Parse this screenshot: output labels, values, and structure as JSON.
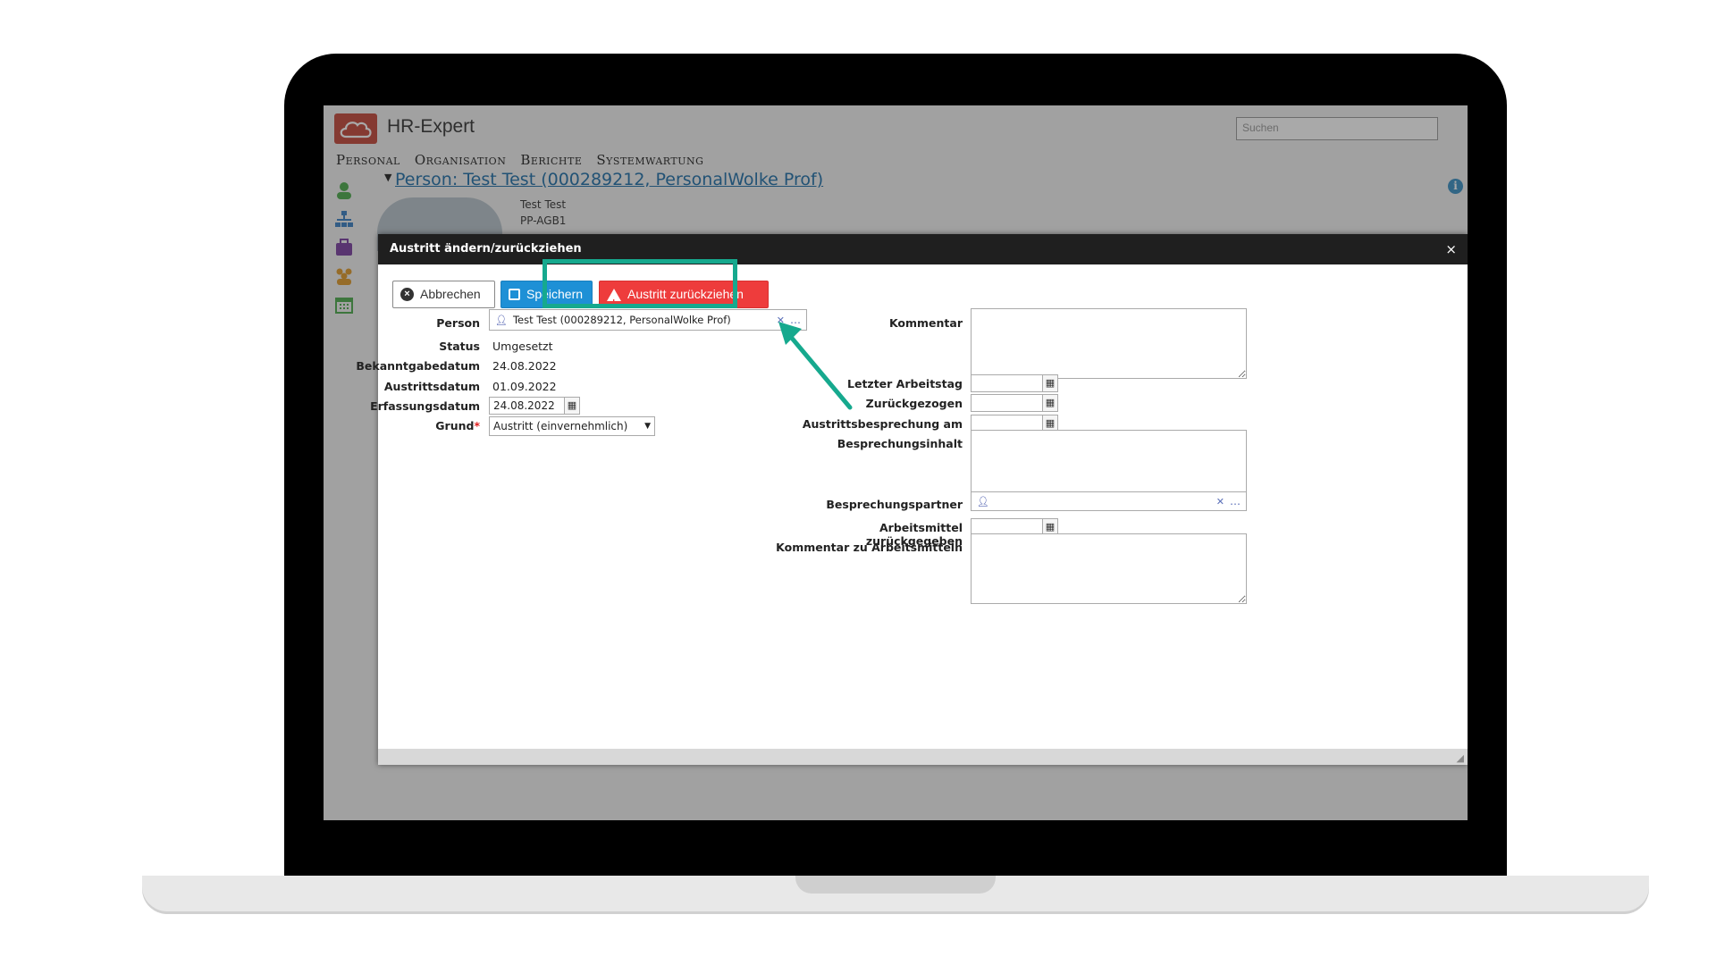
{
  "app": {
    "title": "HR-Expert",
    "search_placeholder": "Suchen",
    "menu": [
      "Personal",
      "Organisation",
      "Berichte",
      "Systemwartung"
    ],
    "person_header": "Person: Test Test (000289212, PersonalWolke Prof)",
    "person_sub_name": "Test Test",
    "person_sub_code": "PP-AGB1"
  },
  "dialog": {
    "title": "Austritt ändern/zurückziehen",
    "close": "×",
    "buttons": {
      "cancel": "Abbrechen",
      "save": "Speichern",
      "revoke": "Austritt zurückziehen"
    },
    "left": {
      "person_label": "Person",
      "person_value": "Test Test (000289212, PersonalWolke Prof)",
      "status_label": "Status",
      "status_value": "Umgesetzt",
      "announce_label": "Bekanntgabedatum",
      "announce_value": "24.08.2022",
      "exit_label": "Austrittsdatum",
      "exit_value": "01.09.2022",
      "record_label": "Erfassungsdatum",
      "record_value": "24.08.2022",
      "reason_label": "Grund",
      "reason_required": "*",
      "reason_value": "Austritt (einvernehmlich)"
    },
    "right": {
      "comment_label": "Kommentar",
      "comment_value": "",
      "last_day_label": "Letzter Arbeitstag",
      "last_day_value": "",
      "withdrawn_label": "Zurückgezogen",
      "withdrawn_value": "",
      "exit_talk_label": "Austrittsbesprechung am",
      "exit_talk_value": "",
      "talk_content_label": "Besprechungsinhalt",
      "talk_content_value": "",
      "talk_partner_label": "Besprechungspartner",
      "talk_partner_value": "",
      "equipment_label": "Arbeitsmittel zurückgegeben",
      "equipment_value": "",
      "equipment_comment_label": "Kommentar zu Arbeitsmitteln",
      "equipment_comment_value": ""
    }
  },
  "colors": {
    "highlight": "#16a98e",
    "revoke_button": "#ee3c3c",
    "save_button": "#1e90d6",
    "header_bar": "#1f1f1f"
  }
}
